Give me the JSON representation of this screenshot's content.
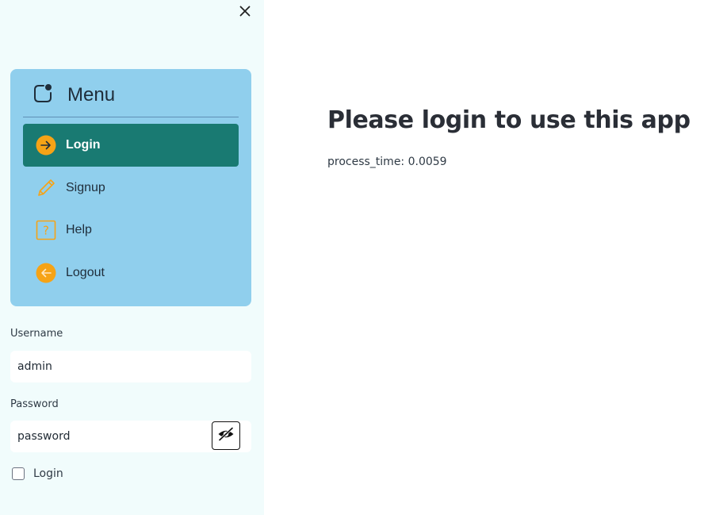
{
  "sidebar": {
    "close_icon": "close-icon",
    "menu": {
      "title": "Menu",
      "icon": "menu-app-icon",
      "items": [
        {
          "label": "Login",
          "icon": "arrow-right-circle-icon",
          "active": true
        },
        {
          "label": "Signup",
          "icon": "pencil-icon",
          "active": false
        },
        {
          "label": "Help",
          "icon": "question-square-icon",
          "active": false
        },
        {
          "label": "Logout",
          "icon": "arrow-left-circle-icon",
          "active": false
        }
      ]
    },
    "username": {
      "label": "Username",
      "value": "admin"
    },
    "password": {
      "label": "Password",
      "value": "password",
      "toggle_icon": "eye-slash-icon"
    },
    "login_checkbox": {
      "label": "Login",
      "checked": false
    }
  },
  "main": {
    "title": "Please login to use this app",
    "process_time": "process_time: 0.0059"
  },
  "colors": {
    "sidebar_bg": "#f1fcfc",
    "menu_bg": "#90cfed",
    "active_item_bg": "#197a72",
    "icon_accent": "#f6a316"
  }
}
